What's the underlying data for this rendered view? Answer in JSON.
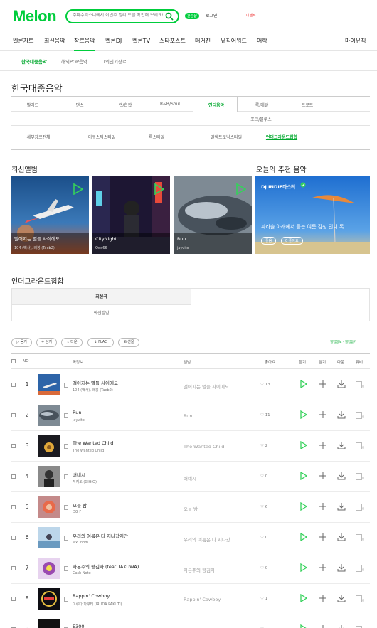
{
  "header": {
    "logo": "Melon",
    "search_placeholder": "주파수리스너에서 이번주 빌리 트를 확인해 보세요!",
    "badge": "관광샵",
    "login_text": "로그인",
    "notice": "이벤트"
  },
  "gnb": {
    "items": [
      "멜론차트",
      "최신음악",
      "장르음악",
      "멜론DJ",
      "멜론TV",
      "스타포스트",
      "매거진",
      "뮤직어워드",
      "어학"
    ],
    "mymusic": "마이뮤직",
    "active_index": 2
  },
  "subnav": {
    "items": [
      "한국대중음악",
      "해외POP음악",
      "그외인기장르"
    ],
    "active_index": 0
  },
  "page_title": "한국대중음악",
  "genres": {
    "row1": [
      "발라드",
      "댄스",
      "랩/힙합",
      "R&B/Soul",
      "인디음악",
      "록/메탈",
      "트로트"
    ],
    "row1b": [
      "포크/블루스"
    ],
    "row2": [
      "세부장르전체",
      "어쿠스틱스타일",
      "록스타일",
      "일렉트로닉스타일",
      "언더그라운드힙합"
    ],
    "active_row1": 4,
    "active_row2": 4
  },
  "latest_albums": {
    "title": "최신앨범",
    "cards": [
      {
        "title": "떨어지는 별들 사이에도",
        "artist": "104 (백사), 래봉 (Taeb2)"
      },
      {
        "title": "CityNight",
        "artist": "Odd66"
      },
      {
        "title": "Run",
        "artist": "jayvito"
      }
    ]
  },
  "recommend": {
    "title": "오늘의 추천 음악",
    "dj": "DJ INDIE마스터",
    "headline": "파라솔 아래에서 듣는 여름 감성 인디 록",
    "btn1": "좋음",
    "btn2": "0 좋아요"
  },
  "section2_title": "언더그라운드힙합",
  "tabs": [
    "최신곡",
    "최신앨범"
  ],
  "toolbar": {
    "buttons": [
      "듣기",
      "담기",
      "다운",
      "FLAC",
      "선물"
    ],
    "right_note": "앨범정보 · 앨범듣기"
  },
  "table_headers": {
    "no": "NO",
    "song": "곡정보",
    "album": "앨범",
    "like": "좋아요",
    "listen": "듣기",
    "add": "담기",
    "download": "다운",
    "video": "뮤비"
  },
  "songs": [
    {
      "no": "1",
      "title": "떨어지는 별들 사이에도",
      "artist": "104 (백사), 래봉 (Taeb2)",
      "album": "떨어지는 별들 사이에도",
      "likes": "13"
    },
    {
      "no": "2",
      "title": "Run",
      "artist": "jayvito",
      "album": "Run",
      "likes": "11"
    },
    {
      "no": "3",
      "title": "The Wanted Child",
      "artist": "The Wanted Child",
      "album": "The Wanted Child",
      "likes": "2"
    },
    {
      "no": "4",
      "title": "버네시",
      "artist": "지지오 (GIGIO)",
      "album": "버네시",
      "likes": "0"
    },
    {
      "no": "5",
      "title": "오늘 밤",
      "artist": "DG F",
      "album": "오늘 밤",
      "likes": "6"
    },
    {
      "no": "6",
      "title": "우리의 여름은 다 지나갔지만",
      "artist": "wxOnom",
      "album": "우리의 여름은 다 지나갔...",
      "likes": "0"
    },
    {
      "no": "7",
      "title": "자본주의 왕김자 (feat.TAKUWA)",
      "artist": "Cash Note",
      "album": "자본주의 왕김자",
      "likes": "0"
    },
    {
      "no": "8",
      "title": "Rappin' Cowboy",
      "artist": "이루다 파쿠티 (IRUDA PAKUTI)",
      "album": "Rappin' Cowboy",
      "likes": "1"
    },
    {
      "no": "9",
      "title": "E300",
      "artist": "",
      "album": "",
      "likes": ""
    }
  ],
  "colors": {
    "accent": "#00cd3c",
    "accent_dark": "#00a82d"
  }
}
